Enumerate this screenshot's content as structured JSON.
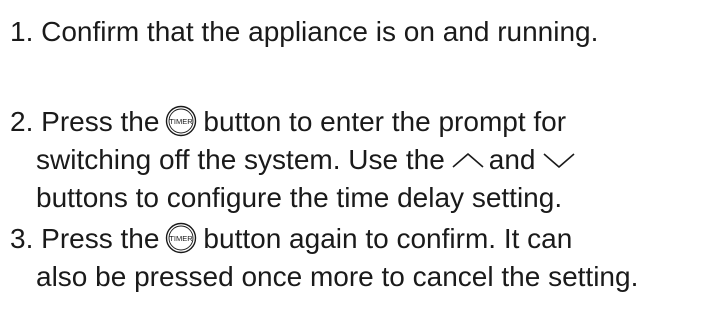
{
  "steps": [
    {
      "number": "1.",
      "line1": "Confirm that the appliance is on and running."
    },
    {
      "number": "2.",
      "line1_before": "Press the",
      "line1_after": "button to enter the prompt for",
      "line2_before": "switching off the system. Use the",
      "line2_middle": "and",
      "line3": "buttons to configure the time delay setting."
    },
    {
      "number": "3.",
      "line1_before": "Press the",
      "line1_after": "button again to confirm. It can",
      "line2": "also be pressed once more to cancel the setting."
    }
  ],
  "icons": {
    "timer_button_label": "TIMER",
    "up_arrow": "chevron-up-icon",
    "down_arrow": "chevron-down-icon"
  }
}
